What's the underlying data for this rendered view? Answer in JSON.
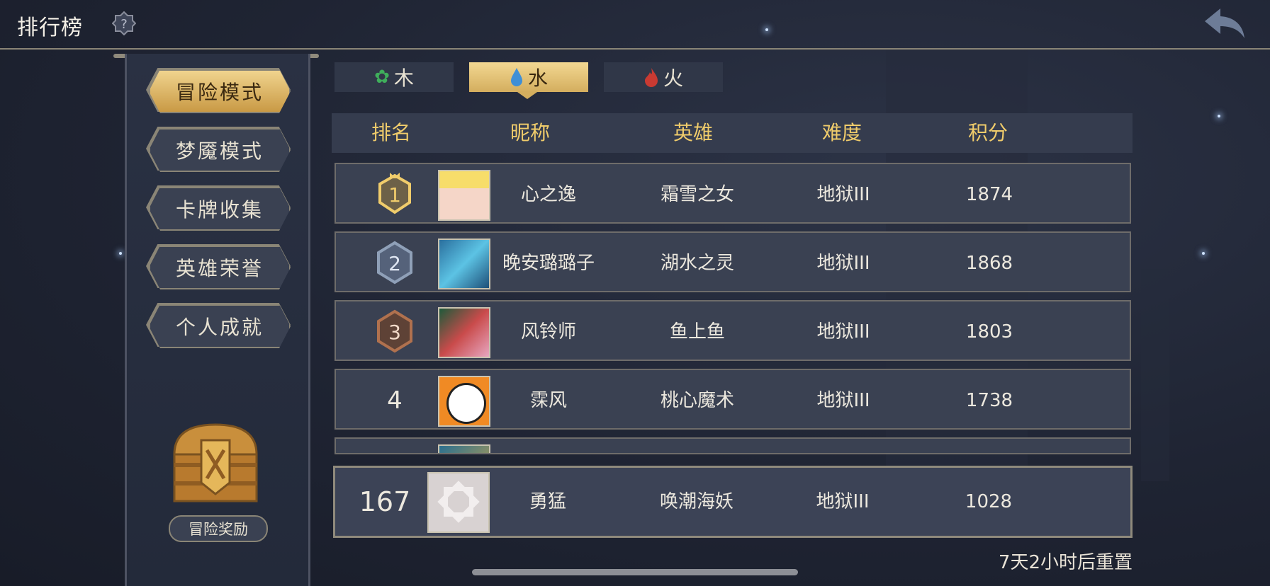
{
  "header": {
    "title": "排行榜",
    "help_icon": "question-icon",
    "back_icon": "back-arrow-icon"
  },
  "sidebar": {
    "items": [
      {
        "label": "冒险模式",
        "active": true
      },
      {
        "label": "梦魇模式",
        "active": false
      },
      {
        "label": "卡牌收集",
        "active": false
      },
      {
        "label": "英雄荣誉",
        "active": false
      },
      {
        "label": "个人成就",
        "active": false
      }
    ],
    "reward_label": "冒险奖励"
  },
  "tabs": [
    {
      "label": "木",
      "icon": "leaf-icon",
      "color": "#3fae5b",
      "active": false
    },
    {
      "label": "水",
      "icon": "water-drop-icon",
      "color": "#3f8fd6",
      "active": true
    },
    {
      "label": "火",
      "icon": "flame-icon",
      "color": "#c93a32",
      "active": false
    }
  ],
  "table": {
    "headers": [
      "排名",
      "昵称",
      "英雄",
      "难度",
      "积分"
    ],
    "rows": [
      {
        "rank": "1",
        "nickname": "心之逸",
        "hero": "霜雪之女",
        "difficulty": "地狱III",
        "score": "1874"
      },
      {
        "rank": "2",
        "nickname": "晚安璐璐子",
        "hero": "湖水之灵",
        "difficulty": "地狱III",
        "score": "1868"
      },
      {
        "rank": "3",
        "nickname": "风铃师",
        "hero": "鱼上鱼",
        "difficulty": "地狱III",
        "score": "1803"
      },
      {
        "rank": "4",
        "nickname": "霂风",
        "hero": "桃心魔术",
        "difficulty": "地狱III",
        "score": "1738"
      }
    ],
    "my_row": {
      "rank": "167",
      "nickname": "勇猛",
      "hero": "唤潮海妖",
      "difficulty": "地狱III",
      "score": "1028"
    }
  },
  "reset_text": "7天2小时后重置",
  "colors": {
    "gold": "#f0cc6b",
    "bronze": "#b0714e",
    "silver": "#8fa0b8"
  }
}
